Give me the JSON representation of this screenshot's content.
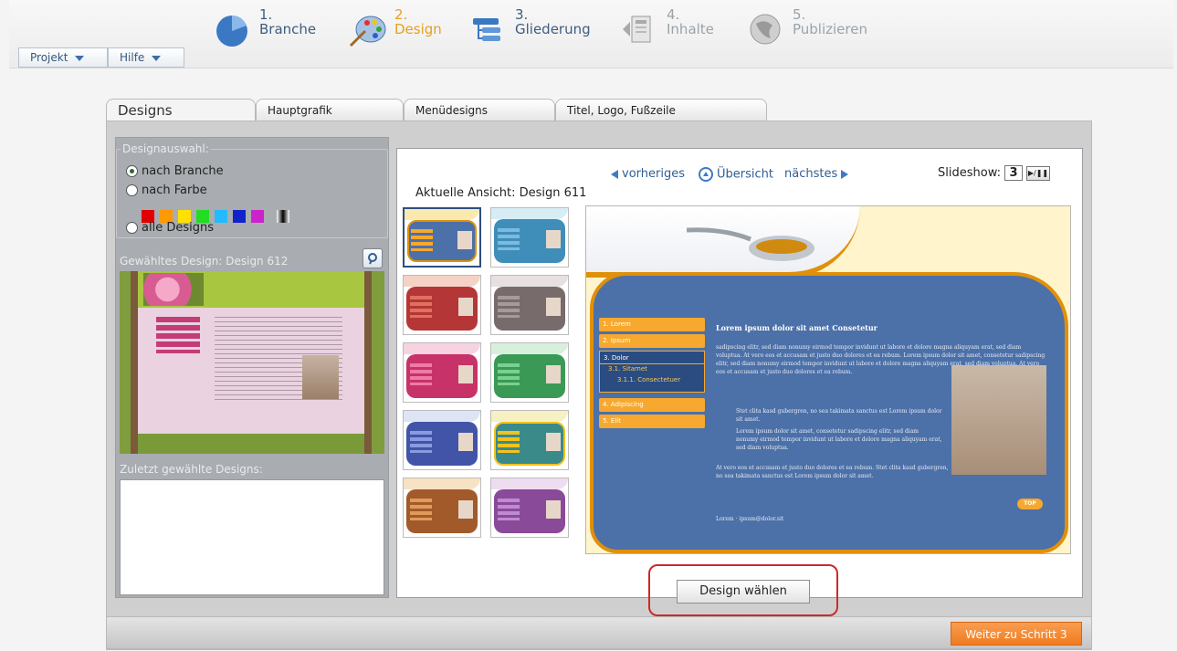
{
  "menu": {
    "projekt": "Projekt",
    "hilfe": "Hilfe"
  },
  "steps": [
    {
      "num": "1.",
      "label": "Branche",
      "state": "done"
    },
    {
      "num": "2.",
      "label": "Design",
      "state": "active"
    },
    {
      "num": "3.",
      "label": "Gliederung",
      "state": "pending"
    },
    {
      "num": "4.",
      "label": "Inhalte",
      "state": "disabled"
    },
    {
      "num": "5.",
      "label": "Publizieren",
      "state": "disabled"
    }
  ],
  "tabs": [
    "Designs",
    "Hauptgrafik",
    "Menüdesigns",
    "Titel, Logo, Fußzeile"
  ],
  "designauswahl": {
    "legend": "Designauswahl:",
    "options": [
      "nach Branche",
      "nach Farbe",
      "alle Designs"
    ],
    "selected": "nach Branche",
    "colors": [
      "#e00000",
      "#ff9900",
      "#ffe000",
      "#22dd22",
      "#22bbff",
      "#1122cc",
      "#cc22cc",
      "#000000"
    ]
  },
  "chosen": {
    "label": "Gewähltes Design: Design 612"
  },
  "recent": {
    "label": "Zuletzt gewählte Designs:"
  },
  "nav": {
    "prev": "vorheriges",
    "overview": "Übersicht",
    "next": "nächstes",
    "slideshow_label": "Slideshow:",
    "slideshow_value": "3"
  },
  "current_view": "Aktuelle Ansicht: Design 611",
  "preview": {
    "menu": [
      "1. Lorem",
      "2. Ipsum",
      "3. Dolor",
      "3.1. Sitamet",
      "3.1.1. Consectetuer",
      "4. Adipiscing",
      "5. Elit"
    ],
    "title": "Lorem ipsum dolor sit amet Consetetur",
    "para1": "sadipscing elitr, sed diam nonumy eirmod tempor invidunt ut labore et dolore magna aliquyam erat, sed diam voluptua. At vero eos et accusam et justo duo dolores et ea rebum. Lorem ipsum dolor sit amet, consetetur sadipscing elitr, sed diam nonumy eirmod tempor invidunt ut labore et dolore magna aliquyam erat, sed diam voluptua. At vero eos et accusam et justo duo dolores et ea rebum.",
    "bullet1": "Stet clita kasd gubergren, no sea takimata sanctus est Lorem ipsum dolor sit amet.",
    "bullet2": "Lorem ipsum dolor sit amet, consetetur sadipscing elitr, sed diam nonumy eirmod tempor invidunt ut labore et dolore magna aliquyam erat, sed diam voluptua.",
    "para2": "At vero eos et accusam et justo duo dolores et ea rebum. Stet clita kasd gubergren, no sea takimata sanctus est Lorem ipsum dolor sit amet.",
    "top": "TOP",
    "footer": "Lorem · ipsum@dolor.sit"
  },
  "buttons": {
    "choose": "Design wählen",
    "next": "Weiter zu Schritt 3"
  },
  "colors": {
    "accent_orange": "#f07c21",
    "link_blue": "#2f5f92",
    "highlight_red": "#cc2a2a"
  }
}
